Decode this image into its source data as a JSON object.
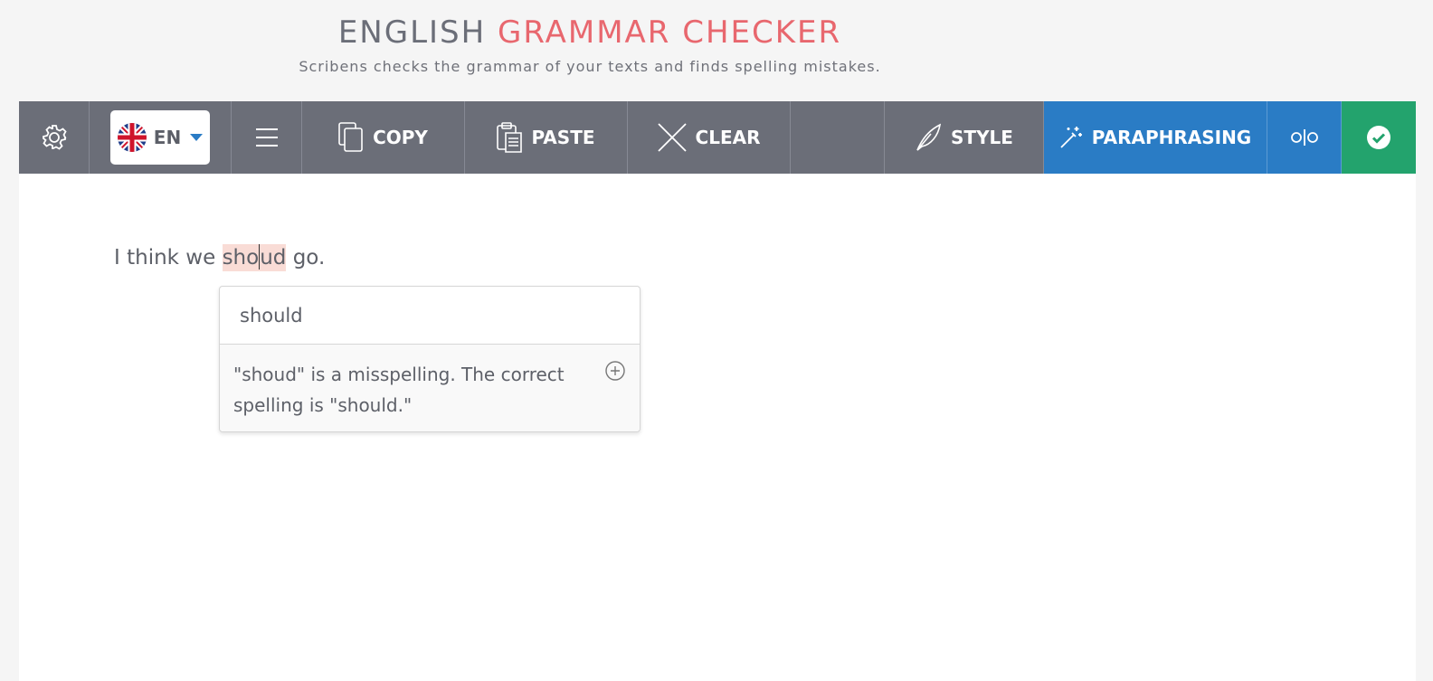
{
  "header": {
    "title_part1": "ENGLISH",
    "title_part2": "GRAMMAR CHECKER",
    "subtitle": "Scribens checks the grammar of your texts and finds spelling mistakes."
  },
  "toolbar": {
    "language_code": "EN",
    "copy_label": "COPY",
    "paste_label": "PASTE",
    "clear_label": "CLEAR",
    "style_label": "STYLE",
    "paraphrasing_label": "PARAPHRASING"
  },
  "colors": {
    "toolbar_bg": "#6b6e78",
    "accent_red": "#e8676e",
    "paraphrase_blue": "#2a7cc5",
    "check_green": "#23a36d",
    "error_highlight": "#f9dcd6"
  },
  "icons": [
    "gear-icon",
    "uk-flag-icon",
    "dropdown-caret-icon",
    "menu-icon",
    "copy-icon",
    "paste-icon",
    "clear-x-icon",
    "feather-icon",
    "magic-wand-icon",
    "split-view-icon",
    "check-circle-icon",
    "plus-circle-icon"
  ],
  "editor": {
    "text_before": "I think we ",
    "error_word_part1": "sho",
    "error_word_part2": "ud",
    "text_after": " go."
  },
  "popup": {
    "suggestion": "should",
    "explanation": "\"shoud\" is a misspelling. The correct spelling is \"should.\""
  }
}
